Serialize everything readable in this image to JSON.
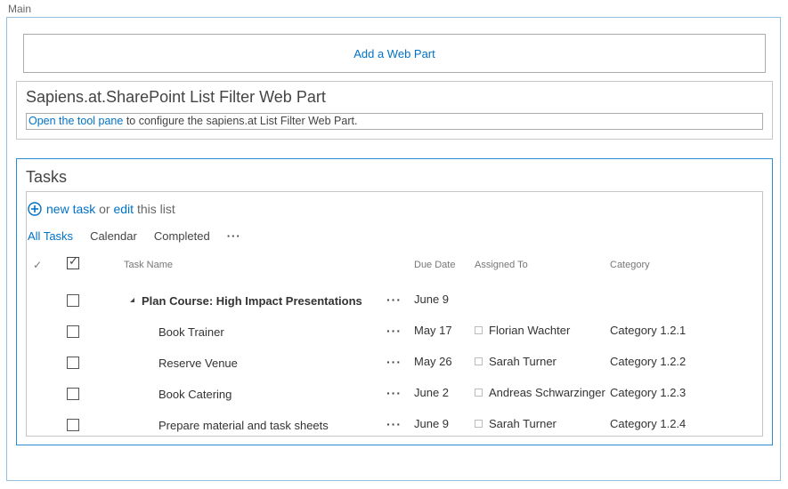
{
  "zone": {
    "label": "Main"
  },
  "add_web_part": {
    "label": "Add a Web Part"
  },
  "filter_web_part": {
    "title": "Sapiens.at.SharePoint List Filter Web Part",
    "link_text": "Open the tool pane",
    "message_rest": " to configure the sapiens.at List Filter Web Part."
  },
  "tasks": {
    "title": "Tasks",
    "new_task": "new task",
    "or": " or ",
    "edit": "edit",
    "this_list": " this list",
    "views": [
      "All Tasks",
      "Calendar",
      "Completed"
    ],
    "more_views": "···",
    "headers": {
      "task_name": "Task Name",
      "due_date": "Due Date",
      "assigned_to": "Assigned To",
      "category": "Category"
    },
    "rows": [
      {
        "name": "Plan Course: High Impact Presentations",
        "due": "June 9",
        "assigned": "",
        "category": ""
      },
      {
        "name": "Book Trainer",
        "due": "May 17",
        "assigned": "Florian Wachter",
        "category": "Category 1.2.1"
      },
      {
        "name": "Reserve Venue",
        "due": "May 26",
        "assigned": "Sarah Turner",
        "category": "Category 1.2.2"
      },
      {
        "name": "Book Catering",
        "due": "June 2",
        "assigned": "Andreas Schwarzinger",
        "category": "Category 1.2.3"
      },
      {
        "name": "Prepare material and task sheets",
        "due": "June 9",
        "assigned": "Sarah Turner",
        "category": "Category 1.2.4"
      }
    ],
    "row_menu": "···"
  },
  "icons": {
    "plus": "plus-circle-icon",
    "check": "checkmark-icon",
    "expand": "collapse-triangle-icon"
  },
  "colors": {
    "link": "#0072c6",
    "zone_border": "#92c0e0",
    "selected_border": "#2a8dd4"
  }
}
